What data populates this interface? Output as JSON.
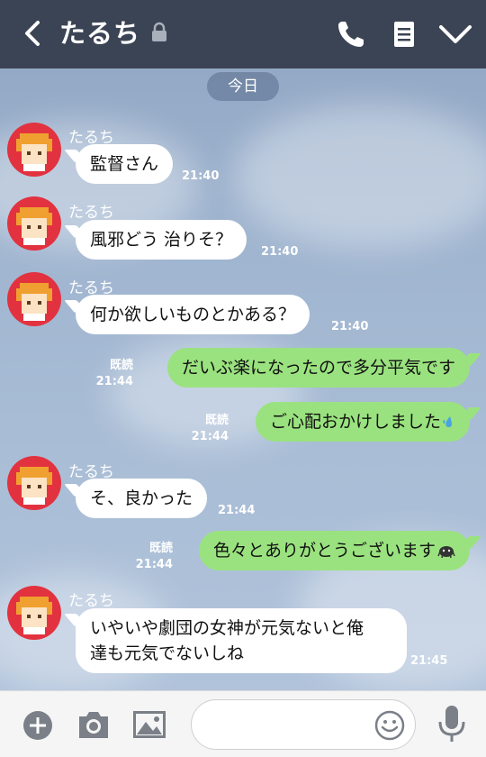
{
  "header": {
    "title": "たるち",
    "icons": [
      "back-arrow-icon",
      "lock-icon",
      "phone-icon",
      "note-icon",
      "chevron-down-icon"
    ],
    "bg_color": "#3b4454"
  },
  "date_label": "今日",
  "messages": [
    {
      "dir": "in",
      "sender": "たるち",
      "text": "監督さん",
      "time": "21:40"
    },
    {
      "dir": "in",
      "sender": "たるち",
      "text": "風邪どう 治りそ？",
      "time": "21:40"
    },
    {
      "dir": "in",
      "sender": "たるち",
      "text": "何か欲しいものとかある？",
      "time": "21:40"
    },
    {
      "dir": "out",
      "read": "既読",
      "text": "だいぶ楽になったので多分平気です",
      "time": "21:44"
    },
    {
      "dir": "out",
      "read": "既読",
      "text": "ご心配おかけしました",
      "emoji": "sweat-drop-icon",
      "time": "21:44"
    },
    {
      "dir": "in",
      "sender": "たるち",
      "text": "そ、良かった",
      "time": "21:44"
    },
    {
      "dir": "out",
      "read": "既読",
      "text": "色々とありがとうございます",
      "emoji": "bowing-icon",
      "time": "21:44"
    },
    {
      "dir": "in",
      "sender": "たるち",
      "line1": "いやいや劇団の女神が元気ないと俺",
      "line2": "達も元気でないしね",
      "time": "21:45"
    }
  ],
  "colors": {
    "outgoing_bubble": "#9ae27f",
    "incoming_bubble": "#ffffff",
    "avatar_bg": "#e2323f"
  },
  "footer": {
    "input_placeholder": "",
    "icons": [
      "add-icon",
      "camera-icon",
      "image-icon",
      "emoji-icon",
      "mic-icon"
    ]
  }
}
